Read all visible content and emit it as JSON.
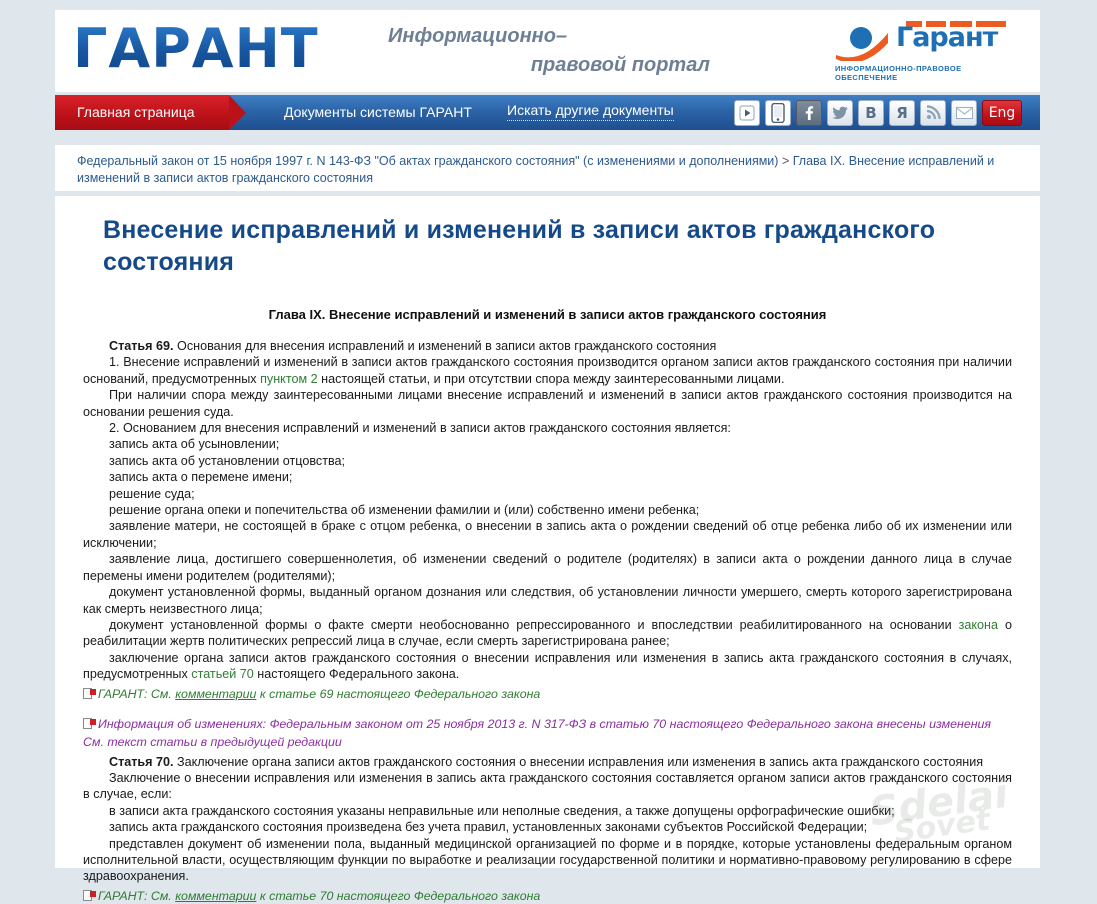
{
  "header": {
    "logo_text": "ГАРАНТ",
    "tagline_line1": "Информационно–",
    "tagline_line2": "правовой портал",
    "corner_logo_word": "Гарант",
    "corner_logo_sub": "ИНФОРМАЦИОННО-ПРАВОВОЕ ОБЕСПЕЧЕНИЕ"
  },
  "nav": {
    "home": "Главная страница",
    "documents": "Документы системы ГАРАНТ",
    "search_other": "Искать другие документы",
    "lang_button": "Eng",
    "social": [
      {
        "name": "video-icon",
        "glyph": "▶"
      },
      {
        "name": "mobile-icon",
        "glyph": "▯"
      },
      {
        "name": "facebook-icon",
        "glyph": "f"
      },
      {
        "name": "twitter-icon",
        "glyph": "t"
      },
      {
        "name": "vk-icon",
        "glyph": "B"
      },
      {
        "name": "yandex-icon",
        "glyph": "Я"
      },
      {
        "name": "rss-icon",
        "glyph": "≋"
      },
      {
        "name": "email-icon",
        "glyph": "✉"
      }
    ]
  },
  "breadcrumb": {
    "parent": "Федеральный закон от 15 ноября 1997 г. N 143-ФЗ \"Об актах гражданского состояния\" (с изменениями и дополнениями)",
    "separator": ">",
    "current": "Глава IX. Внесение исправлений и изменений в записи актов гражданского состояния"
  },
  "document": {
    "title": "Внесение исправлений и изменений в записи актов гражданского состояния",
    "chapter_heading": "Глава IX. Внесение исправлений и изменений в записи актов гражданского состояния",
    "article69": {
      "number": "Статья 69.",
      "heading": " Основания для внесения исправлений и изменений в записи актов гражданского состояния",
      "p1_a": "1. Внесение исправлений и изменений в записи актов гражданского состояния производится органом записи актов гражданского состояния при наличии оснований, предусмотренных ",
      "p1_link": "пунктом 2",
      "p1_b": " настоящей статьи, и при отсутствии спора между заинтересованными лицами.",
      "p2": "При наличии спора между заинтересованными лицами внесение исправлений и изменений в записи актов гражданского состояния производится на основании решения суда.",
      "p3": "2. Основанием для внесения исправлений и изменений в записи актов гражданского состояния является:",
      "items": [
        "запись акта об усыновлении;",
        "запись акта об установлении отцовства;",
        "запись акта о перемене имени;",
        "решение суда;",
        "решение органа опеки и попечительства об изменении фамилии и (или) собственно имени ребенка;",
        "заявление матери, не состоящей в браке с отцом ребенка, о внесении в запись акта о рождении сведений об отце ребенка либо об их изменении или исключении;",
        "заявление лица, достигшего совершеннолетия, об изменении сведений о родителе (родителях) в записи акта о рождении данного лица в случае перемены имени родителем (родителями);",
        "документ установленной формы, выданный органом дознания или следствия, об установлении личности умершего, смерть которого зарегистрирована как смерть неизвестного лица;"
      ],
      "item_repressed_a": "документ установленной формы о факте смерти необоснованно репрессированного и впоследствии реабилитированного на основании ",
      "item_repressed_link": "закона",
      "item_repressed_b": " о реабилитации жертв политических репрессий лица в случае, если смерть зарегистрирована ранее;",
      "item_conclusion_a": "заключение органа записи актов гражданского состояния о внесении исправления или изменения в запись акта гражданского состояния в случаях, предусмотренных ",
      "item_conclusion_link": "статьей 70",
      "item_conclusion_b": " настоящего Федерального закона.",
      "garant_note_label": "ГАРАНТ:",
      "garant_note_pre": " См. ",
      "garant_note_link": "комментарии",
      "garant_note_post": " к статье 69 настоящего Федерального закона"
    },
    "info_block": {
      "label": "Информация об изменениях:",
      "text": " Федеральным законом от 25 ноября 2013 г. N 317-ФЗ в статью 70 настоящего Федерального закона внесены изменения",
      "prev_link": "См. текст статьи в предыдущей редакции"
    },
    "article70": {
      "number": "Статья 70.",
      "heading": " Заключение органа записи актов гражданского состояния о внесении исправления или изменения в запись акта гражданского состояния",
      "p1": "Заключение о внесении исправления или изменения в запись акта гражданского состояния составляется органом записи актов гражданского состояния в случае, если:",
      "items": [
        "в записи акта гражданского состояния указаны неправильные или неполные сведения, а также допущены орфографические ошибки;",
        "запись акта гражданского состояния произведена без учета правил, установленных законами субъектов Российской Федерации;",
        "представлен документ об изменении пола, выданный медицинской организацией по форме и в порядке, которые установлены федеральным органом исполнительной власти, осуществляющим функции по выработке и реализации государственной политики и нормативно-правовому регулированию в сфере здравоохранения."
      ],
      "garant_note_label": "ГАРАНТ:",
      "garant_note_pre": " См. ",
      "garant_note_link": "комментарии",
      "garant_note_post": " к статье 70 настоящего Федерального закона"
    }
  },
  "watermark": {
    "line1": "Sdelai",
    "line2": "Sovet"
  },
  "colors": {
    "page_bg": "#dfe6ec",
    "nav_blue": "#2c64a8",
    "nav_red": "#bb1118",
    "title_blue": "#154a8a",
    "link_green": "#2e7d32",
    "info_purple": "#8b2fa0"
  }
}
